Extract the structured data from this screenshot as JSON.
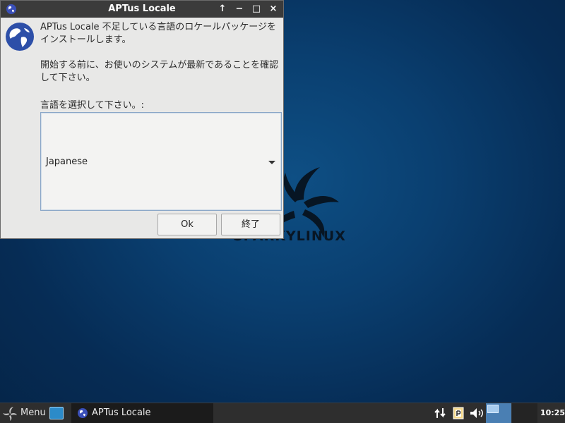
{
  "desktop": {
    "logo_text": "SPARKYLINUX"
  },
  "window": {
    "title": "APTus Locale",
    "controls": {
      "up_symbol": "↑",
      "minimize_symbol": "−",
      "maximize_symbol": "□",
      "close_symbol": "×"
    },
    "message_line1": "APTus Locale 不足している言語のロケールパッケージを",
    "message_line1b": "インストールします。",
    "message_line2": "開始する前に、お使いのシステムが最新であることを確認",
    "message_line2b": "して下さい。",
    "language_label": "言語を選択して下さい。:",
    "language_selected": "Japanese",
    "ok_button": "Ok",
    "quit_button": "終了"
  },
  "taskbar": {
    "menu_label": "Menu",
    "task_label": "APTus Locale",
    "clock": "10:25",
    "icons": [
      "menu-swirl-icon",
      "file-manager-icon",
      "app-globe-icon",
      "network-arrows-icon",
      "package-update-icon",
      "volume-icon"
    ]
  },
  "colors": {
    "titlebar": "#3b3b3b",
    "window_bg": "#e8e8e7",
    "accent_blue": "#4a7fb3",
    "globe_blue": "#2d4fa8"
  }
}
